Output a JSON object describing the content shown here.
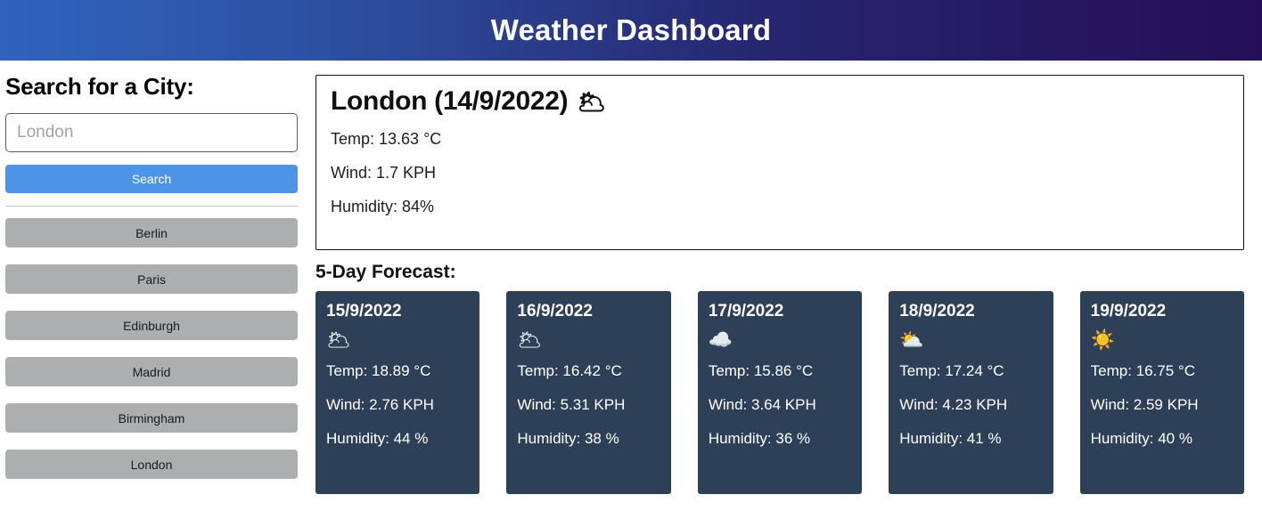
{
  "header": {
    "title": "Weather Dashboard",
    "gradient_from": "#3063bd",
    "gradient_to": "#240f57"
  },
  "sidebar": {
    "heading": "Search for a City:",
    "search_input": {
      "value": "",
      "placeholder": "London"
    },
    "search_button_label": "Search",
    "search_button_color": "#4d94e6",
    "city_button_color": "#adaeb0",
    "cities": [
      {
        "label": "Berlin"
      },
      {
        "label": "Paris"
      },
      {
        "label": "Edinburgh"
      },
      {
        "label": "Madrid"
      },
      {
        "label": "Birmingham"
      },
      {
        "label": "London"
      }
    ]
  },
  "current_weather": {
    "title": "London (14/9/2022)",
    "icon": "broken-clouds-icon",
    "icon_glyph": "🌥",
    "temp": "Temp: 13.63 °C",
    "wind": "Wind: 1.7 KPH",
    "humidity": "Humidity: 84%"
  },
  "forecast": {
    "heading": "5-Day Forecast:",
    "card_color": "#2e4057",
    "days": [
      {
        "date": "15/9/2022",
        "icon": "broken-clouds-icon",
        "icon_glyph": "🌥",
        "temp": "Temp: 18.89 °C",
        "wind": "Wind: 2.76 KPH",
        "humidity": "Humidity: 44 %"
      },
      {
        "date": "16/9/2022",
        "icon": "broken-clouds-icon",
        "icon_glyph": "🌥",
        "temp": "Temp: 16.42 °C",
        "wind": "Wind: 5.31 KPH",
        "humidity": "Humidity: 38 %"
      },
      {
        "date": "17/9/2022",
        "icon": "cloud-icon",
        "icon_glyph": "☁️",
        "temp": "Temp: 15.86 °C",
        "wind": "Wind: 3.64 KPH",
        "humidity": "Humidity: 36 %"
      },
      {
        "date": "18/9/2022",
        "icon": "sun-behind-cloud-icon",
        "icon_glyph": "⛅",
        "temp": "Temp: 17.24 °C",
        "wind": "Wind: 4.23 KPH",
        "humidity": "Humidity: 41 %"
      },
      {
        "date": "19/9/2022",
        "icon": "sun-icon",
        "icon_glyph": "☀️",
        "temp": "Temp: 16.75 °C",
        "wind": "Wind: 2.59 KPH",
        "humidity": "Humidity: 40 %"
      }
    ]
  }
}
